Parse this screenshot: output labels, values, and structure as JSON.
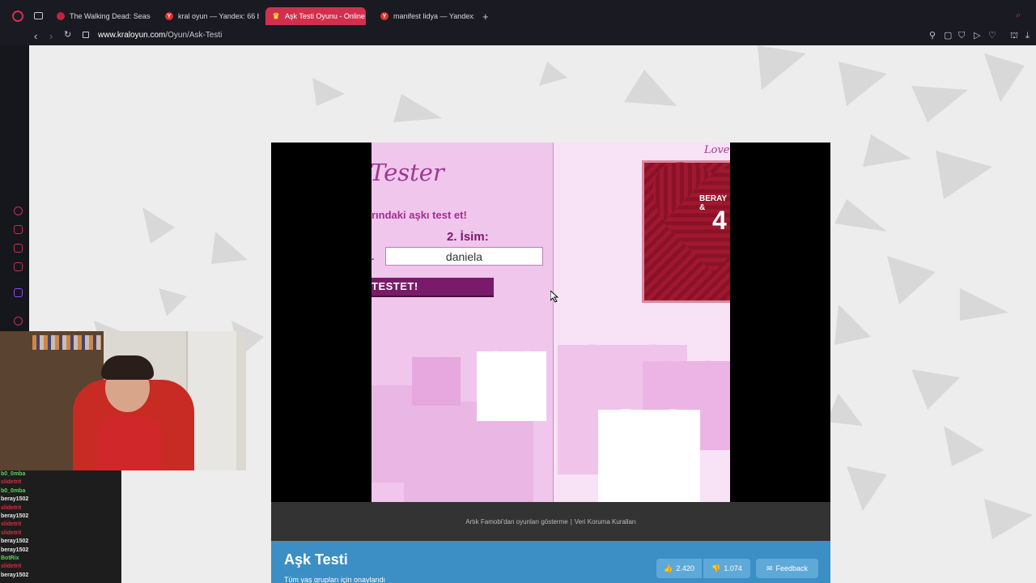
{
  "tabs": [
    {
      "label": "The Walking Dead: Seaso",
      "favicon": "tv-icon",
      "active": false
    },
    {
      "label": "kral oyun — Yandex: 66 b",
      "favicon": "yandex-icon",
      "active": false
    },
    {
      "label": "Aşk Testi Oyunu - Online",
      "favicon": "crown-icon",
      "active": true
    },
    {
      "label": "manifest lidya — Yandex:",
      "favicon": "yandex-icon",
      "active": false
    }
  ],
  "address": {
    "host": "www.kraloyun.com",
    "path": "/Oyun/Ask-Testi"
  },
  "game": {
    "title": "Tester",
    "subtitle": "rındaki aşkı test et!",
    "name2_label": "2. İsim:",
    "name2_value": "daniela",
    "test_button": "TESTET!",
    "love_text": "Love",
    "result_names": "BERAY &",
    "result_percent": "4"
  },
  "footer_links": {
    "left": "Artık Famobi'dan oyunları gösterme",
    "sep": "|",
    "right": "Veri Koruma Kuralları"
  },
  "info": {
    "title": "Aşk Testi",
    "subtitle": "Tüm yaş grupları için onaylandı",
    "likes": "2.420",
    "dislikes": "1.074",
    "feedback": "Feedback"
  },
  "chat": [
    {
      "user": "b0_0mba",
      "color": "#5bd35b"
    },
    {
      "user": "slidetrit",
      "color": "#d03040"
    },
    {
      "user": "b0_0mba",
      "color": "#5bd35b"
    },
    {
      "user": "beray1502",
      "color": "#e8e8e8"
    },
    {
      "user": "slidetrit",
      "color": "#d03040"
    },
    {
      "user": "beray1502",
      "color": "#e8e8e8"
    },
    {
      "user": "slidetrit",
      "color": "#d03040"
    },
    {
      "user": "slidetrit",
      "color": "#d03040"
    },
    {
      "user": "beray1502",
      "color": "#e8e8e8"
    },
    {
      "user": "beray1502",
      "color": "#e8e8e8"
    },
    {
      "user": "BotRix",
      "color": "#5bd35b"
    },
    {
      "user": "slidetrit",
      "color": "#d03040"
    },
    {
      "user": "beray1502",
      "color": "#e8e8e8"
    }
  ],
  "colors": {
    "accent": "#d1304d",
    "button": "#7a1a6a",
    "info_bar": "#3b8fc4",
    "game_pink": "#f0c6ec"
  }
}
